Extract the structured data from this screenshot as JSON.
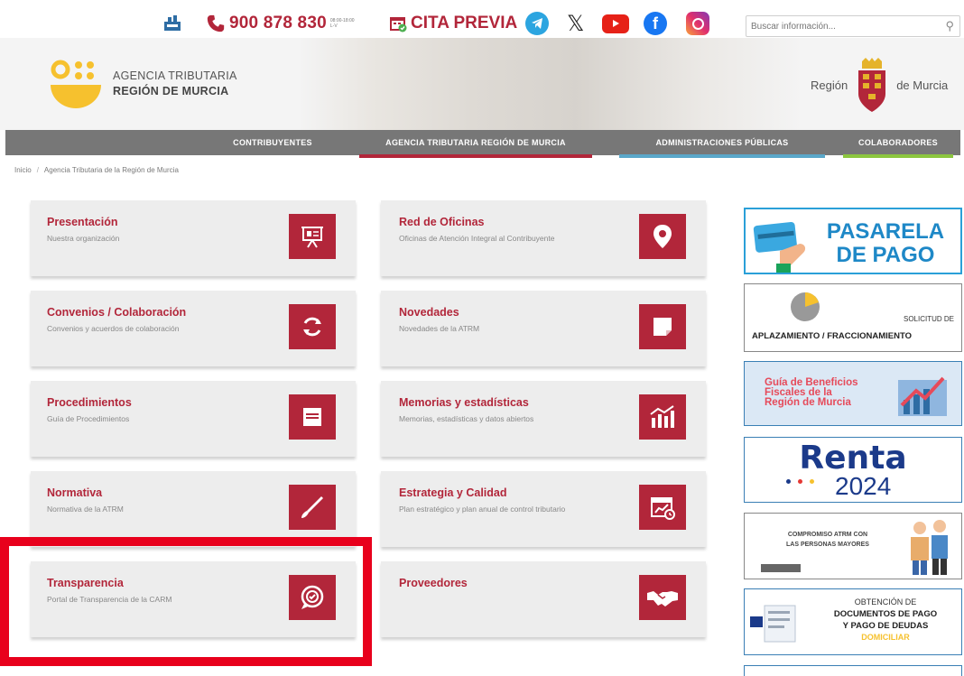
{
  "topbar": {
    "phone": "900 878 830",
    "phone_hours": "08:00-18:00 L-V",
    "cita_label": "CITA PREVIA",
    "search_placeholder": "Buscar información..."
  },
  "header": {
    "agency_line1": "AGENCIA TRIBUTARIA",
    "agency_line2": "REGIÓN DE MURCIA",
    "region_left": "Región",
    "region_right": "de Murcia"
  },
  "nav": {
    "items": [
      {
        "label": "CONTRIBUYENTES",
        "color": "#777777"
      },
      {
        "label": "AGENCIA TRIBUTARIA REGIÓN DE MURCIA",
        "color": "#b2263a"
      },
      {
        "label": "ADMINISTRACIONES PÚBLICAS",
        "color": "#5aa7c9"
      },
      {
        "label": "COLABORADORES",
        "color": "#8cc63f"
      }
    ]
  },
  "breadcrumb": {
    "home": "Inicio",
    "current": "Agencia Tributaria de la Región de Murcia"
  },
  "cards": [
    {
      "title": "Presentación",
      "subtitle": "Nuestra organización",
      "icon": "presentation-icon"
    },
    {
      "title": "Red de Oficinas",
      "subtitle": "Oficinas de Atención Integral al Contribuyente",
      "icon": "location-pin-icon"
    },
    {
      "title": "Convenios / Colaboración",
      "subtitle": "Convenios y acuerdos de colaboración",
      "icon": "refresh-icon"
    },
    {
      "title": "Novedades",
      "subtitle": "Novedades de la ATRM",
      "icon": "note-icon"
    },
    {
      "title": "Procedimientos",
      "subtitle": "Guía de Procedimientos",
      "icon": "document-icon"
    },
    {
      "title": "Memorias y estadísticas",
      "subtitle": "Memorias, estadísticas y datos abiertos",
      "icon": "chart-icon"
    },
    {
      "title": "Normativa",
      "subtitle": "Normativa de la ATRM",
      "icon": "pen-icon"
    },
    {
      "title": "Estrategia y Calidad",
      "subtitle": "Plan estratégico y plan anual de control tributario",
      "icon": "calendar-chart-icon"
    },
    {
      "title": "Transparencia",
      "subtitle": "Portal de Transparencia de la CARM",
      "icon": "transparency-icon"
    },
    {
      "title": "Proveedores",
      "subtitle": "",
      "icon": "handshake-icon"
    }
  ],
  "side": {
    "pasarela_l1": "PASARELA",
    "pasarela_l2": "DE PAGO",
    "aplaz_l1": "SOLICITUD DE",
    "aplaz_l2": "APLAZAMIENTO / FRACCIONAMIENTO",
    "guia_l1": "Guía de Beneficios",
    "guia_l2": "Fiscales de la",
    "guia_l3": "Región de Murcia",
    "renta_title": "Renta",
    "renta_year": "2024",
    "mayores_l1": "COMPROMISO ATRM CON",
    "mayores_l2": "LAS PERSONAS MAYORES",
    "docs_l1": "OBTENCIÓN DE",
    "docs_l2": "DOCUMENTOS DE PAGO",
    "docs_l3": "Y PAGO DE DEUDAS",
    "docs_l4": "DOMICILIAR"
  },
  "colors": {
    "brand_red": "#b2263a",
    "highlight_red": "#e8001c",
    "logo_yellow": "#f6c12e",
    "nav_gray": "#777777",
    "pasarela_blue": "#1e88c7"
  }
}
